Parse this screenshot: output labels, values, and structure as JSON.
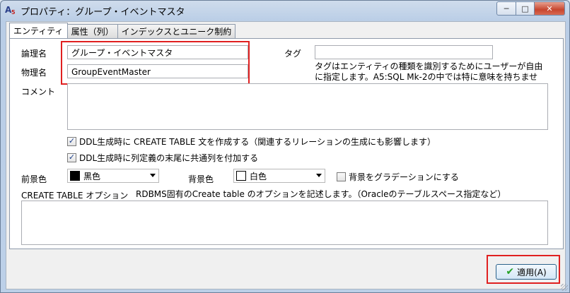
{
  "window": {
    "title": "プロパティ：グループ・イベントマスタ",
    "app_icon": "a5-app-icon",
    "controls": {
      "minimize": "─",
      "maximize": "□",
      "close": "✕"
    }
  },
  "tabs": [
    {
      "label": "エンティティ",
      "active": true
    },
    {
      "label": "属性（列）",
      "active": false
    },
    {
      "label": "インデックスとユニーク制約",
      "active": false
    }
  ],
  "entity": {
    "logical_name_label": "論理名",
    "logical_name_value": "グループ・イベントマスタ",
    "physical_name_label": "物理名",
    "physical_name_value": "GroupEventMaster",
    "tag_label": "タグ",
    "tag_value": "",
    "tag_note_line1": "タグはエンティティの種類を識別するためにユーザーが自由",
    "tag_note_line2": "に指定します。A5:SQL Mk-2の中では特に意味を持ちませ",
    "comment_label": "コメント",
    "comment_value": ""
  },
  "options": {
    "ddl_create_table": {
      "label": "DDL生成時に CREATE TABLE 文を作成する（関連するリレーションの生成にも影響します）",
      "checked": true
    },
    "ddl_common_columns": {
      "label": "DDL生成時に列定義の末尾に共通列を付加する",
      "checked": true
    },
    "fore_color_label": "前景色",
    "fore_color_value": "黒色",
    "fore_color_hex": "#000000",
    "back_color_label": "背景色",
    "back_color_value": "白色",
    "back_color_hex": "#ffffff",
    "gradient": {
      "label": "背景をグラデーションにする",
      "checked": false
    }
  },
  "create_table_option": {
    "label": "CREATE TABLE オプション",
    "note": "RDBMS固有のCreate table のオプションを記述します。（Oracleのテーブルスペース指定など）",
    "value": ""
  },
  "apply_button": {
    "label": "適用(A)",
    "icon": "check-icon"
  },
  "colors": {
    "highlight": "#e02020",
    "accent": "#2c628b"
  }
}
